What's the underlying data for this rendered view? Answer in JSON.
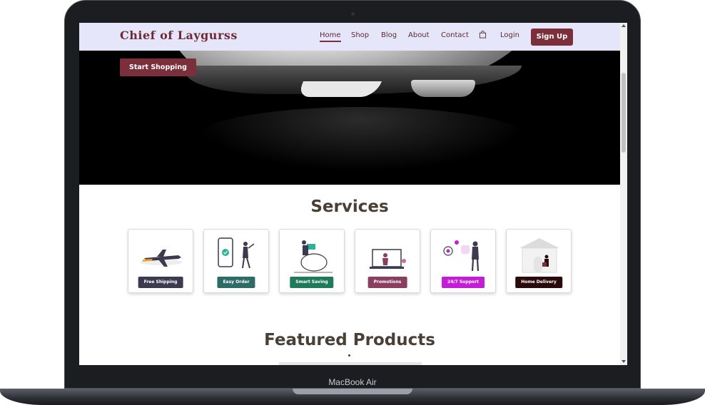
{
  "device": {
    "model_label": "MacBook Air"
  },
  "navbar": {
    "brand": "Chief of Laygurss",
    "links": [
      {
        "label": "Home",
        "active": true
      },
      {
        "label": "Shop"
      },
      {
        "label": "Blog"
      },
      {
        "label": "About"
      },
      {
        "label": "Contact"
      }
    ],
    "cart_icon": "shopping-bag-icon",
    "login_label": "Login",
    "signup_label": "Sign Up"
  },
  "hero": {
    "cta_label": "Start Shopping"
  },
  "services": {
    "title": "Services",
    "items": [
      {
        "label": "Free Shipping",
        "icon": "airplane-icon",
        "color": "#3c3a4e"
      },
      {
        "label": "Easy Order",
        "icon": "phone-order-icon",
        "color": "#2e6b66"
      },
      {
        "label": "Smart Saving",
        "icon": "piggy-bank-icon",
        "color": "#1f7a5c"
      },
      {
        "label": "Promotions",
        "icon": "laptop-promo-icon",
        "color": "#8a3f60"
      },
      {
        "label": "24/7 Support",
        "icon": "support-chat-icon",
        "color": "#c21ed6"
      },
      {
        "label": "Home Delivery",
        "icon": "house-delivery-icon",
        "color": "#2a0a0a"
      }
    ]
  },
  "featured": {
    "title": "Featured Products"
  },
  "colors": {
    "brand": "#7a2f3a",
    "navbar_bg": "#e6e6fa",
    "heading": "#4a3f35"
  }
}
